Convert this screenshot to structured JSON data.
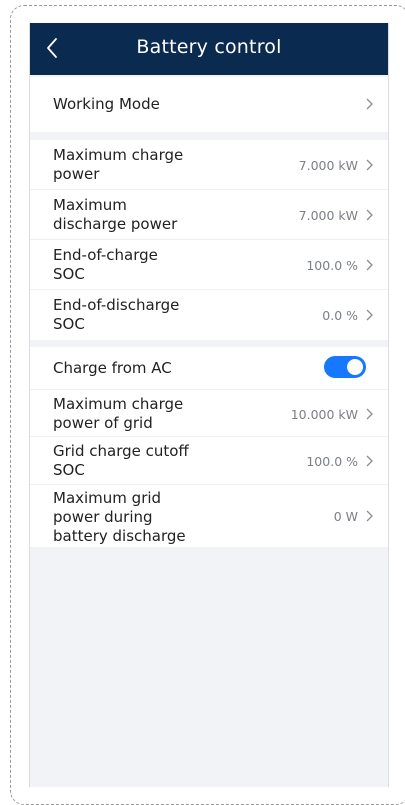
{
  "header": {
    "title": "Battery control",
    "back_icon": "chevron-left-icon"
  },
  "sections": {
    "mode": {
      "working_mode_label": "Working Mode"
    },
    "limits": {
      "max_charge_label_1": "Maximum charge",
      "max_charge_label_2": "power",
      "max_charge_value": "7.000 kW",
      "max_discharge_label_1": "Maximum",
      "max_discharge_label_2": "discharge power",
      "max_discharge_value": "7.000 kW",
      "end_charge_label_1": "End-of-charge",
      "end_charge_label_2": "SOC",
      "end_charge_value": "100.0 %",
      "end_discharge_label_1": "End-of-discharge",
      "end_discharge_label_2": "SOC",
      "end_discharge_value": "0.0 %"
    },
    "grid": {
      "charge_from_ac_label": "Charge from AC",
      "charge_from_ac_on": true,
      "max_grid_charge_label_1": "Maximum charge",
      "max_grid_charge_label_2": "power of grid",
      "max_grid_charge_value": "10.000 kW",
      "grid_cutoff_label_1": "Grid charge cutoff",
      "grid_cutoff_label_2": "SOC",
      "grid_cutoff_value": "100.0 %",
      "max_grid_discharge_label_1": "Maximum grid",
      "max_grid_discharge_label_2": "power during",
      "max_grid_discharge_label_3": "battery discharge",
      "max_grid_discharge_value": "0 W"
    }
  },
  "colors": {
    "header_bg": "#0b2a4f",
    "toggle_on": "#1677ff",
    "page_bg": "#f1f3f6"
  }
}
